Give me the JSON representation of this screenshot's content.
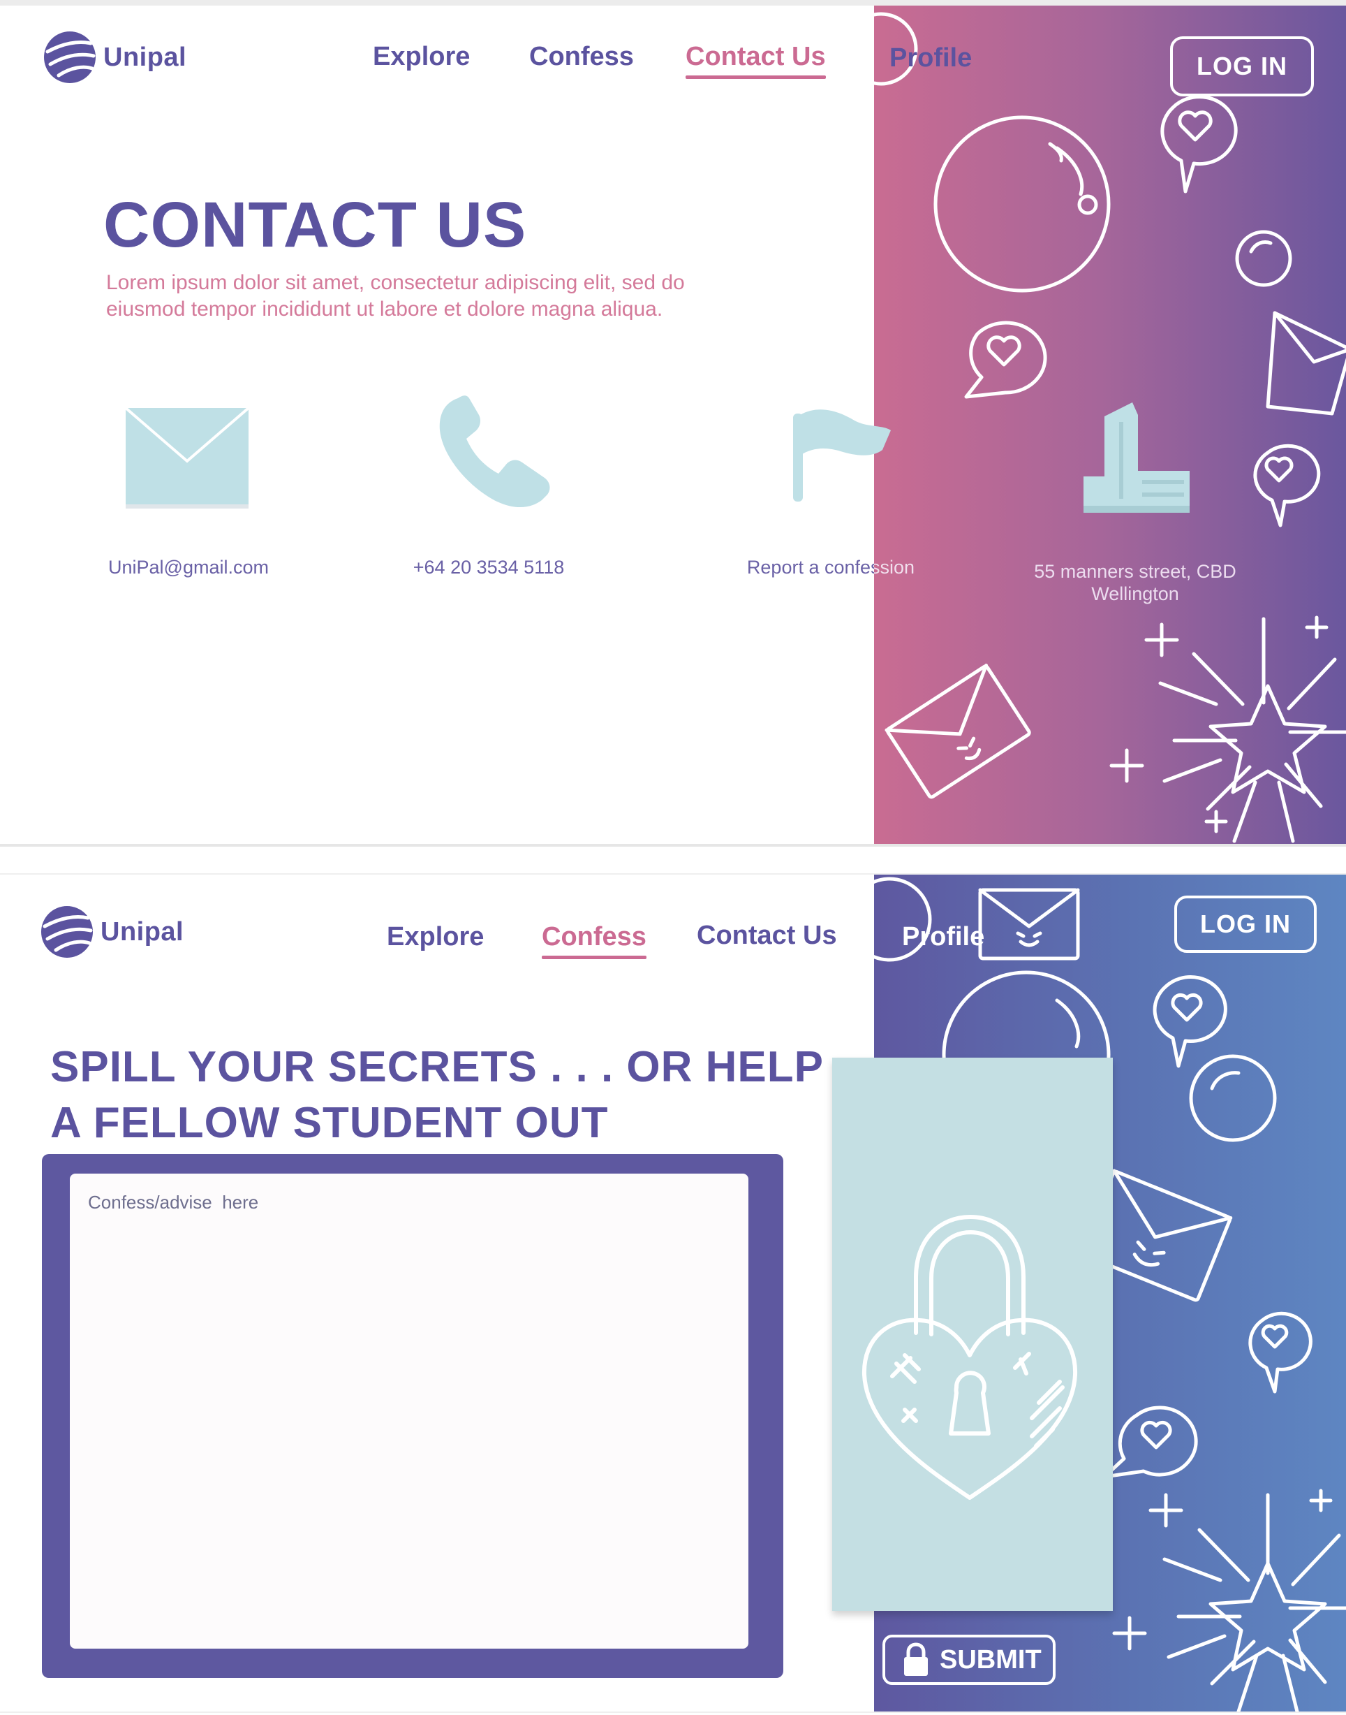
{
  "brand": {
    "name": "Unipal"
  },
  "contact_page": {
    "nav": [
      {
        "label": "Explore",
        "active": false
      },
      {
        "label": "Confess",
        "active": false
      },
      {
        "label": "Contact Us",
        "active": true
      },
      {
        "label": "Profile",
        "active": false
      }
    ],
    "login_label": "LOG IN",
    "title": "CONTACT US",
    "lead_line1": "Lorem ipsum dolor sit amet, consectetur adipiscing elit, sed do",
    "lead_line2": "eiusmod tempor incididunt ut labore et dolore magna aliqua.",
    "contacts": [
      {
        "icon": "envelope-icon",
        "text": "UniPal@gmail.com"
      },
      {
        "icon": "phone-icon",
        "text": "+64 20 3534 5118"
      },
      {
        "icon": "flag-icon",
        "text": "Report a confession"
      },
      {
        "icon": "building-icon",
        "line1": "55 manners street, CBD",
        "line2": "Wellington"
      }
    ]
  },
  "confess_page": {
    "nav": [
      {
        "label": "Explore",
        "active": false
      },
      {
        "label": "Confess",
        "active": true
      },
      {
        "label": "Contact Us",
        "active": false
      },
      {
        "label": "Profile",
        "active": false
      }
    ],
    "login_label": "LOG IN",
    "title_line1": "SPILL YOUR SECRETS . . . OR HELP",
    "title_line2": "A FELLOW STUDENT OUT",
    "textarea_placeholder": "Confess/advise  here",
    "lock_icon": "heart-padlock-icon",
    "submit_label": "SUBMIT"
  },
  "colors": {
    "brand_purple": "#5b539f",
    "accent_pink": "#cb6a92",
    "icon_light_blue": "#c4dfe3",
    "gradient_contact": [
      "#c96c92",
      "#6a579e"
    ],
    "gradient_confess": [
      "#5e58a0",
      "#5e86c2"
    ]
  }
}
